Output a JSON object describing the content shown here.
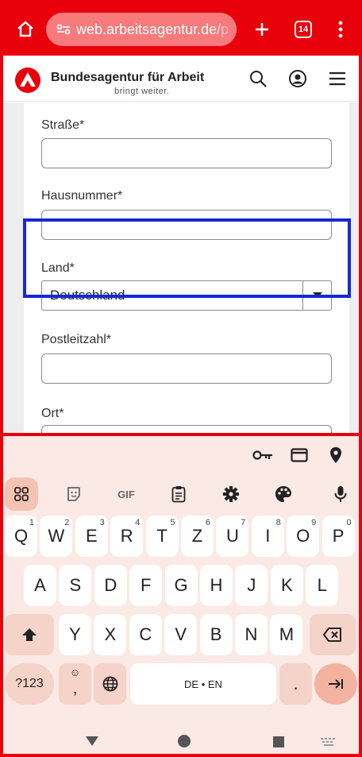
{
  "browser": {
    "url": "web.arbeitsagentur.de/p",
    "tab_count": "14"
  },
  "site": {
    "brand": "Bundesagentur für Arbeit",
    "tagline": "bringt weiter."
  },
  "form": {
    "street_label": "Straße*",
    "street_value": "",
    "house_number_label": "Hausnummer*",
    "house_number_value": "",
    "country_label": "Land*",
    "country_value": "Deutschland",
    "postal_code_label": "Postleitzahl*",
    "postal_code_value": "",
    "city_label": "Ort*"
  },
  "keyboard": {
    "toolbar": [
      "apps-grid-icon",
      "sticker-icon",
      "GIF",
      "clipboard-icon",
      "settings-icon",
      "palette-icon",
      "mic-icon"
    ],
    "suggestions": [
      "key-icon",
      "card-icon",
      "location-pin-icon"
    ],
    "row1": [
      {
        "k": "Q",
        "h": "1"
      },
      {
        "k": "W",
        "h": "2"
      },
      {
        "k": "E",
        "h": "3"
      },
      {
        "k": "R",
        "h": "4"
      },
      {
        "k": "T",
        "h": "5"
      },
      {
        "k": "Z",
        "h": "6"
      },
      {
        "k": "U",
        "h": "7"
      },
      {
        "k": "I",
        "h": "8"
      },
      {
        "k": "O",
        "h": "9"
      },
      {
        "k": "P",
        "h": "0"
      }
    ],
    "row2": [
      "A",
      "S",
      "D",
      "F",
      "G",
      "H",
      "J",
      "K",
      "L"
    ],
    "row3": [
      "Y",
      "X",
      "C",
      "V",
      "B",
      "N",
      "M"
    ],
    "symbols_label": "?123",
    "comma_label": ",",
    "space_label": "DE • EN",
    "period_label": ".",
    "gif_label": "GIF"
  },
  "colors": {
    "brand_red": "#e8000b",
    "highlight_blue": "#1628d6",
    "keyboard_bg": "#fbe9e5"
  }
}
